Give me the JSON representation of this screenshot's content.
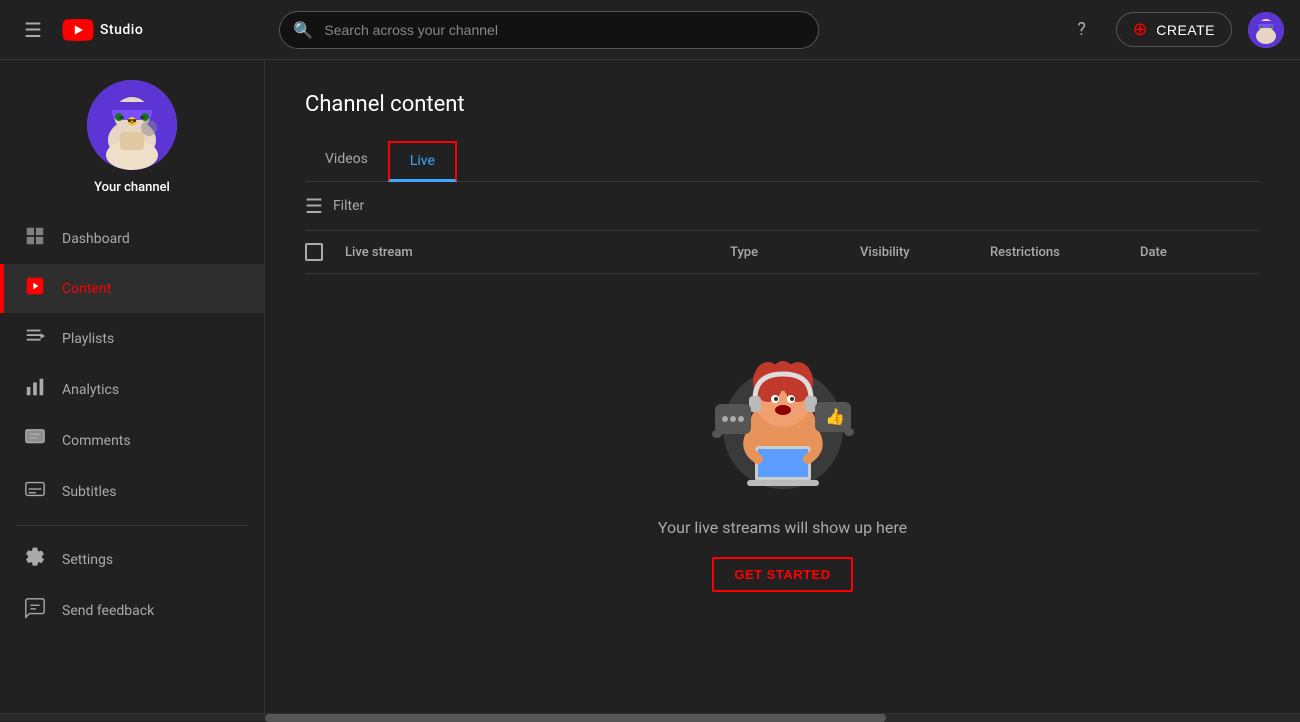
{
  "header": {
    "menu_label": "Menu",
    "logo_text": "Studio",
    "search_placeholder": "Search across your channel",
    "help_label": "Help",
    "create_label": "CREATE",
    "avatar_label": "User avatar"
  },
  "sidebar": {
    "channel_name": "Your channel",
    "items": [
      {
        "id": "dashboard",
        "label": "Dashboard",
        "icon": "⊞"
      },
      {
        "id": "content",
        "label": "Content",
        "icon": "▶",
        "active": true
      },
      {
        "id": "playlists",
        "label": "Playlists",
        "icon": "☰"
      },
      {
        "id": "analytics",
        "label": "Analytics",
        "icon": "📊"
      },
      {
        "id": "comments",
        "label": "Comments",
        "icon": "💬"
      },
      {
        "id": "subtitles",
        "label": "Subtitles",
        "icon": "⬛"
      }
    ],
    "bottom_items": [
      {
        "id": "settings",
        "label": "Settings",
        "icon": "⚙"
      },
      {
        "id": "feedback",
        "label": "Send feedback",
        "icon": "💬"
      }
    ]
  },
  "main": {
    "page_title": "Channel content",
    "tabs": [
      {
        "id": "videos",
        "label": "Videos",
        "active": false
      },
      {
        "id": "live",
        "label": "Live",
        "active": true
      }
    ],
    "filter_label": "Filter",
    "table": {
      "columns": [
        {
          "id": "stream",
          "label": "Live stream"
        },
        {
          "id": "type",
          "label": "Type"
        },
        {
          "id": "visibility",
          "label": "Visibility"
        },
        {
          "id": "restrictions",
          "label": "Restrictions"
        },
        {
          "id": "date",
          "label": "Date"
        }
      ]
    },
    "empty_state": {
      "text": "Your live streams will show up here",
      "cta_label": "GET STARTED"
    }
  }
}
